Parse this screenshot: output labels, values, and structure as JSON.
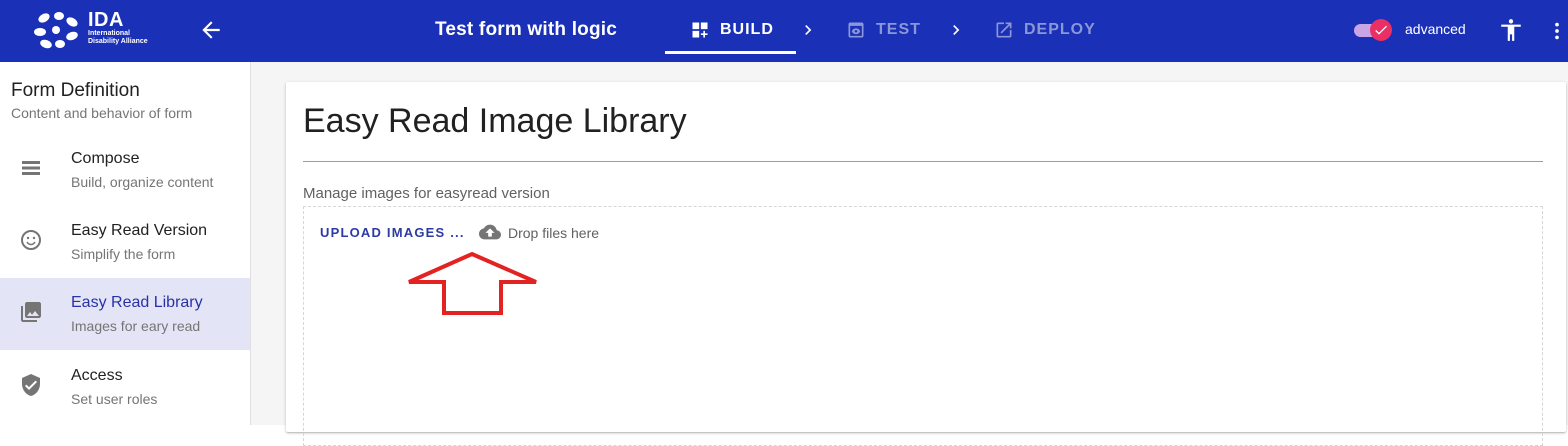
{
  "header": {
    "logo": {
      "name": "IDA",
      "line1": "International",
      "line2": "Disability Alliance"
    },
    "back_icon": "arrow-left-icon",
    "form_title": "Test form with logic",
    "steps": [
      {
        "label": "BUILD",
        "icon": "build-grid-icon",
        "active": true
      },
      {
        "label": "TEST",
        "icon": "eye-preview-icon",
        "active": false
      },
      {
        "label": "DEPLOY",
        "icon": "open-external-icon",
        "active": false
      }
    ],
    "advanced_toggle": {
      "label": "advanced",
      "on": true
    },
    "accessibility_icon": "accessibility-icon",
    "more_icon": "more-vertical-icon",
    "colors": {
      "bar": "#1a30b6",
      "toggle": "#ea2f64",
      "active_nav_bg": "#e3e4f5"
    }
  },
  "sidebar": {
    "title": "Form Definition",
    "subtitle": "Content and behavior of form",
    "items": [
      {
        "label": "Compose",
        "sub": "Build, organize content",
        "icon": "list-icon",
        "active": false
      },
      {
        "label": "Easy Read Version",
        "sub": "Simplify the form",
        "icon": "smiley-icon",
        "active": false
      },
      {
        "label": "Easy Read Library",
        "sub": "Images for eary read",
        "icon": "image-library-icon",
        "active": true
      },
      {
        "label": "Access",
        "sub": "Set user roles",
        "icon": "shield-check-icon",
        "active": false
      }
    ]
  },
  "main": {
    "title": "Easy Read Image Library",
    "description": "Manage images for easyread version",
    "upload_button": "UPLOAD IMAGES ...",
    "drop_icon": "cloud-upload-icon",
    "drop_text": "Drop files here"
  }
}
